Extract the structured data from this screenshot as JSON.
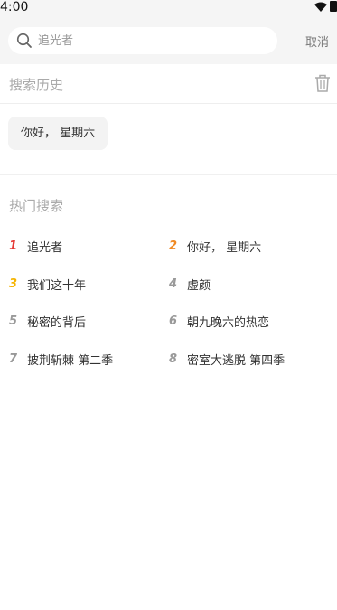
{
  "status_bar": {
    "time": "4:00"
  },
  "search": {
    "placeholder": "追光者",
    "cancel_label": "取消"
  },
  "history": {
    "title": "搜索历史",
    "items": [
      "你好， 星期六"
    ]
  },
  "hot": {
    "title": "热门搜索",
    "items": [
      {
        "rank": "1",
        "label": "追光者",
        "rank_color": "#e53935"
      },
      {
        "rank": "2",
        "label": "你好， 星期六",
        "rank_color": "#f08a24"
      },
      {
        "rank": "3",
        "label": "我们这十年",
        "rank_color": "#f5b400"
      },
      {
        "rank": "4",
        "label": "虚颜",
        "rank_color": "#999999"
      },
      {
        "rank": "5",
        "label": "秘密的背后",
        "rank_color": "#999999"
      },
      {
        "rank": "6",
        "label": "朝九晚六的热恋",
        "rank_color": "#999999"
      },
      {
        "rank": "7",
        "label": "披荆斩棘 第二季",
        "rank_color": "#999999"
      },
      {
        "rank": "8",
        "label": "密室大逃脱 第四季",
        "rank_color": "#999999"
      }
    ]
  }
}
